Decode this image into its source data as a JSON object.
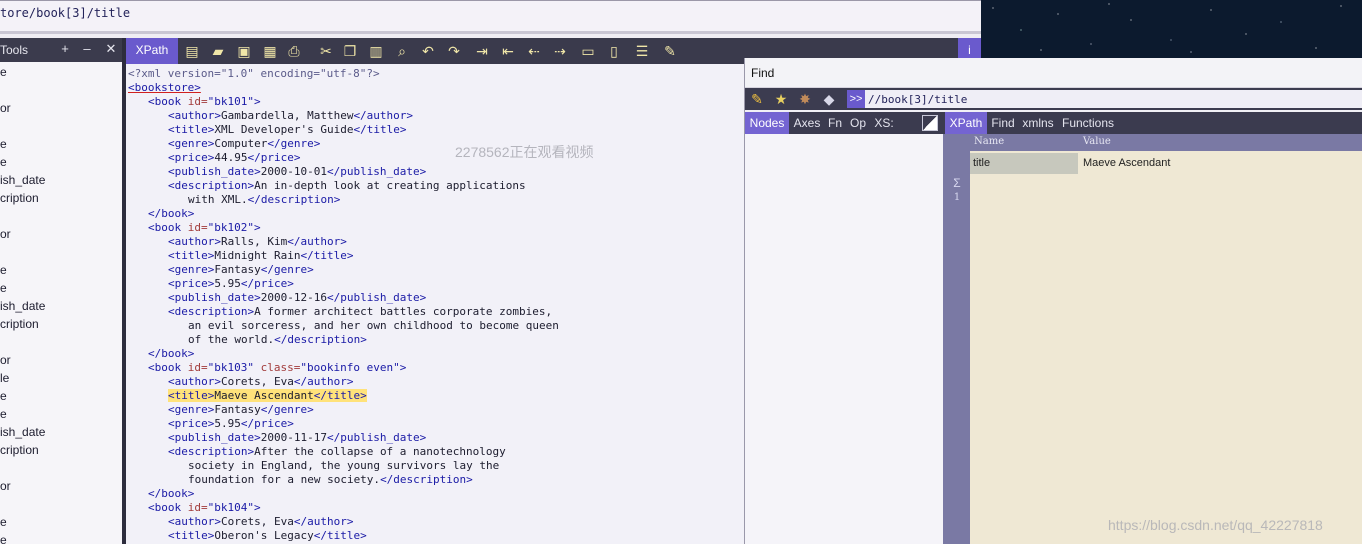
{
  "top_xpath_text": "tore/book[3]/title",
  "tools_panel": {
    "title": "Tools",
    "add_label": "+",
    "remove_label": "–",
    "close_label": "✕",
    "tree_items": [
      "e",
      "or",
      "e",
      "e",
      "ish_date",
      "cription",
      "or",
      "e",
      "e",
      "ish_date",
      "cription",
      "or",
      "le",
      "e",
      "e",
      "ish_date",
      "cription",
      "or",
      "e",
      "e"
    ]
  },
  "toolbar": {
    "xpath_tab_label": "XPath",
    "info_label": "i",
    "icons": [
      "new-file-icon",
      "open-folder-icon",
      "save-icon",
      "save-as-icon",
      "print-icon",
      "cut-icon",
      "copy-icon",
      "paste-icon",
      "find-icon",
      "undo-icon",
      "redo-icon",
      "indent-icon",
      "outdent-icon",
      "move-left-icon",
      "move-right-icon",
      "collapse-icon",
      "expand-icon",
      "format-icon",
      "edit-icon"
    ]
  },
  "editor": {
    "xml_declaration": "<?xml version=\"1.0\" encoding=\"utf-8\"?>",
    "root_open": "<bookstore>",
    "lines": [
      "<book id=\"bk101\">",
      "<author>Gambardella, Matthew</author>",
      "<title>XML Developer's Guide</title>",
      "<genre>Computer</genre>",
      "<price>44.95</price>",
      "<publish_date>2000-10-01</publish_date>",
      "<description>An in-depth look at creating applications",
      "with XML.</description>",
      "</book>",
      "<book id=\"bk102\">",
      "<author>Ralls, Kim</author>",
      "<title>Midnight Rain</title>",
      "<genre>Fantasy</genre>",
      "<price>5.95</price>",
      "<publish_date>2000-12-16</publish_date>",
      "<description>A former architect battles corporate zombies,",
      "an evil sorceress, and her own childhood to become queen",
      "of the world.</description>",
      "</book>",
      "<book id=\"bk103\" class=\"bookinfo even\">",
      "<author>Corets, Eva</author>",
      "<title>Maeve Ascendant</title>",
      "<genre>Fantasy</genre>",
      "<price>5.95</price>",
      "<publish_date>2000-11-17</publish_date>",
      "<description>After the collapse of a nanotechnology",
      "society in England, the young survivors lay the",
      "foundation for a new society.</description>",
      "</book>",
      "<book id=\"bk104\">",
      "<author>Corets, Eva</author>",
      "<title>Oberon's Legacy</title>"
    ]
  },
  "watermarks": {
    "center": "2278562正在观看视频",
    "bottom": "https://blog.csdn.net/qq_42227818"
  },
  "find_window": {
    "title": "Find",
    "expand_label": ">>",
    "query": "//book[3]/title",
    "left_tabs": [
      "Nodes",
      "Axes",
      "Fn",
      "Op",
      "XS:"
    ],
    "right_tabs": [
      "XPath",
      "Find",
      "xmlns",
      "Functions"
    ],
    "results": {
      "sigma": "Σ",
      "count": "1",
      "columns": [
        "Name",
        "Value"
      ],
      "rows": [
        {
          "name": "title",
          "value": "Maeve Ascendant"
        }
      ]
    }
  },
  "colors": {
    "accent": "#6a5acd",
    "toolbar_bg": "#3a3a4c",
    "highlight": "#ffe27a",
    "tag_blue": "#1a1aa6",
    "attr_red": "#a23b3b"
  }
}
